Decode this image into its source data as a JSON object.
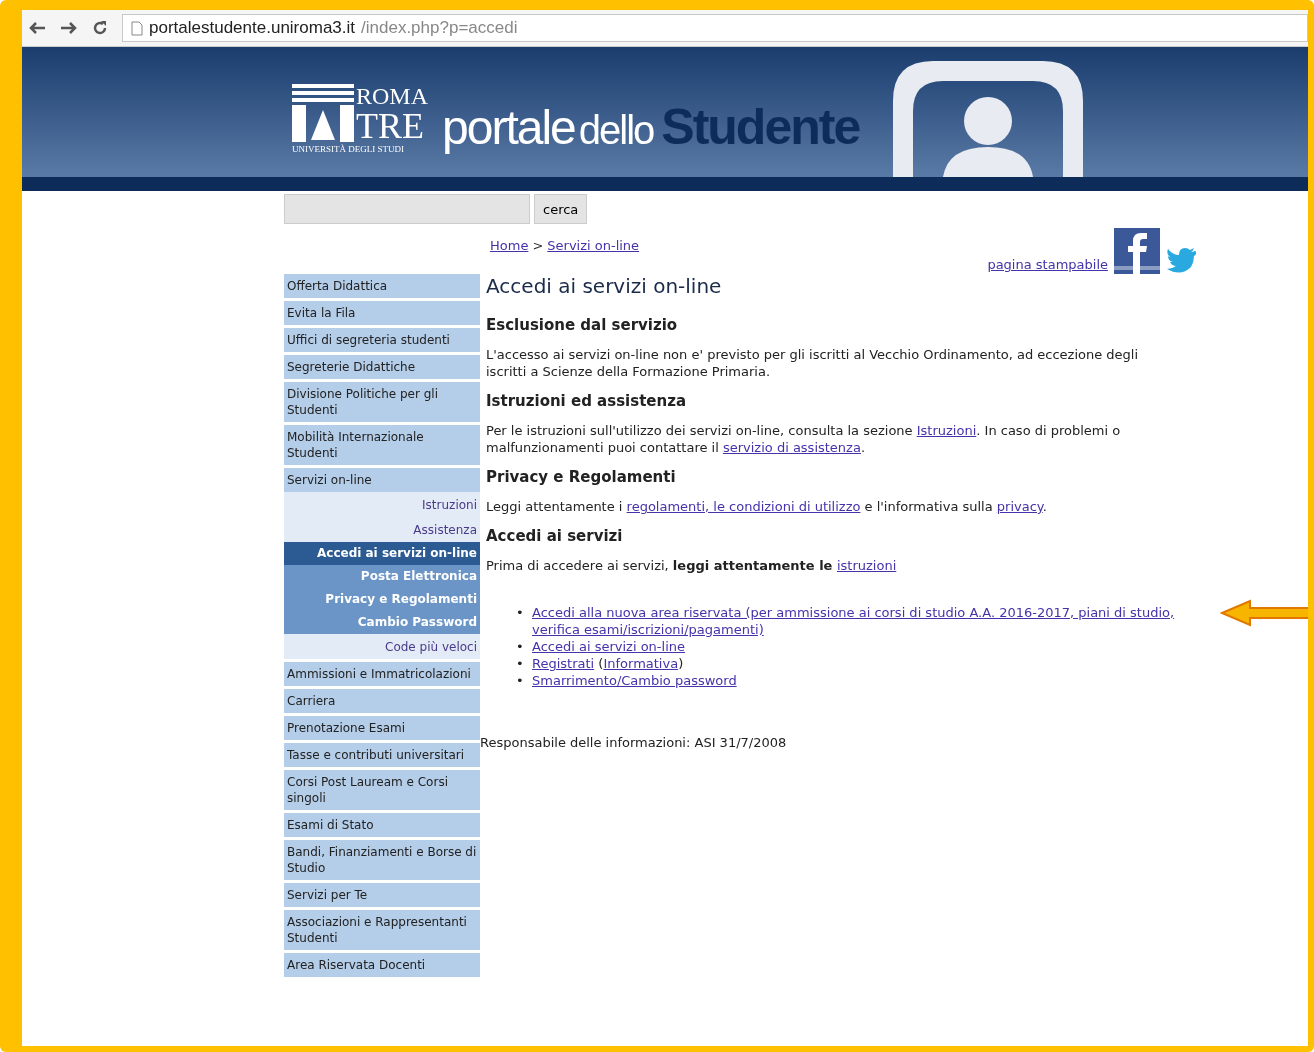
{
  "browser": {
    "url_host": "portalestudente.uniroma3.it",
    "url_path": "/index.php?p=accedi"
  },
  "header": {
    "logo_top": "ROMA",
    "logo_main": "TRE",
    "logo_sub": "UNIVERSITÀ DEGLI STUDI",
    "title_light": "portale",
    "title_mid": "dello",
    "title_bold": "Studente"
  },
  "search": {
    "button": "cerca"
  },
  "breadcrumb": [
    {
      "label": "Home"
    },
    {
      "label": "Servizi on-line"
    }
  ],
  "breadcrumb_separator": ">",
  "print_link": "pagina stampabile",
  "sidebar": [
    {
      "label": "Offerta Didattica",
      "kind": "main",
      "selected": false
    },
    {
      "label": "Evita la Fila",
      "kind": "main",
      "selected": false
    },
    {
      "label": "Uffici di segreteria studenti",
      "kind": "main",
      "selected": false
    },
    {
      "label": "Segreterie Didattiche",
      "kind": "main",
      "selected": false
    },
    {
      "label": "Divisione Politiche per gli Studenti",
      "kind": "main",
      "selected": false
    },
    {
      "label": "Mobilità Internazionale Studenti",
      "kind": "main",
      "selected": false
    },
    {
      "label": "Servizi on-line",
      "kind": "main",
      "selected": false
    },
    {
      "label": "Istruzioni",
      "kind": "sub",
      "selected": false
    },
    {
      "label": "Assistenza",
      "kind": "sub",
      "selected": false
    },
    {
      "label": "Accedi ai servizi on-line",
      "kind": "subsub",
      "selected": true
    },
    {
      "label": "Posta Elettronica",
      "kind": "subsub",
      "selected": false
    },
    {
      "label": "Privacy e Regolamenti",
      "kind": "subsub",
      "selected": false
    },
    {
      "label": "Cambio Password",
      "kind": "subsub",
      "selected": false
    },
    {
      "label": "Code più veloci",
      "kind": "sub",
      "selected": false
    },
    {
      "label": "Ammissioni e Immatricolazioni",
      "kind": "main",
      "selected": false
    },
    {
      "label": "Carriera",
      "kind": "main",
      "selected": false
    },
    {
      "label": "Prenotazione Esami",
      "kind": "main",
      "selected": false
    },
    {
      "label": "Tasse e contributi universitari",
      "kind": "main",
      "selected": false
    },
    {
      "label": "Corsi Post Lauream e Corsi singoli",
      "kind": "main",
      "selected": false
    },
    {
      "label": "Esami di Stato",
      "kind": "main",
      "selected": false
    },
    {
      "label": "Bandi, Finanziamenti e Borse di Studio",
      "kind": "main",
      "selected": false
    },
    {
      "label": "Servizi per Te",
      "kind": "main",
      "selected": false
    },
    {
      "label": "Associazioni e Rappresentanti Studenti",
      "kind": "main",
      "selected": false
    },
    {
      "label": "Area Riservata Docenti",
      "kind": "main",
      "selected": false
    }
  ],
  "page_title": "Accedi ai servizi on-line",
  "sections": [
    {
      "heading": "Esclusione dal servizio",
      "paragraph": [
        {
          "kind": "text",
          "text": "L'accesso ai servizi on-line non e' previsto per gli iscritti al Vecchio Ordinamento, ad eccezione degli iscritti a Scienze della Formazione Primaria."
        }
      ]
    },
    {
      "heading": "Istruzioni ed assistenza",
      "paragraph": [
        {
          "kind": "text",
          "text": "Per le istruzioni sull'utilizzo dei servizi on-line, consulta la sezione "
        },
        {
          "kind": "link",
          "text": "Istruzioni"
        },
        {
          "kind": "text",
          "text": ". In caso di problemi o malfunzionamenti puoi contattare il "
        },
        {
          "kind": "link",
          "text": "servizio di assistenza"
        },
        {
          "kind": "text",
          "text": "."
        }
      ]
    },
    {
      "heading": "Privacy e Regolamenti",
      "paragraph": [
        {
          "kind": "text",
          "text": "Leggi attentamente i "
        },
        {
          "kind": "link",
          "text": "regolamenti, le condizioni di utilizzo"
        },
        {
          "kind": "text",
          "text": " e l'informativa sulla "
        },
        {
          "kind": "link",
          "text": "privacy"
        },
        {
          "kind": "text",
          "text": "."
        }
      ]
    },
    {
      "heading": "Accedi ai servizi",
      "paragraph": [
        {
          "kind": "text",
          "text": "Prima di accedere ai servizi, "
        },
        {
          "kind": "bold",
          "text": "leggi attentamente le "
        },
        {
          "kind": "link",
          "text": "istruzioni"
        }
      ]
    }
  ],
  "links": [
    {
      "marker": "•",
      "parts": [
        {
          "kind": "link",
          "text": "Accedi alla nuova area riservata (per ammissione ai corsi di studio A.A. 2016-2017, piani di studio, verifica esami/iscrizioni/pagamenti)"
        }
      ],
      "highlighted": true
    },
    {
      "marker": "•",
      "parts": [
        {
          "kind": "link",
          "text": "Accedi ai servizi on-line"
        }
      ],
      "highlighted": false
    },
    {
      "marker": "•",
      "parts": [
        {
          "kind": "link",
          "text": "Registrati"
        },
        {
          "kind": "text",
          "text": " ("
        },
        {
          "kind": "link",
          "text": "Informativa"
        },
        {
          "kind": "text",
          "text": ")"
        }
      ],
      "highlighted": false
    },
    {
      "marker": "•",
      "parts": [
        {
          "kind": "link",
          "text": "Smarrimento/Cambio password"
        }
      ],
      "highlighted": false
    }
  ],
  "footer_note": "Responsabile delle informazioni: ASI 31/7/2008"
}
